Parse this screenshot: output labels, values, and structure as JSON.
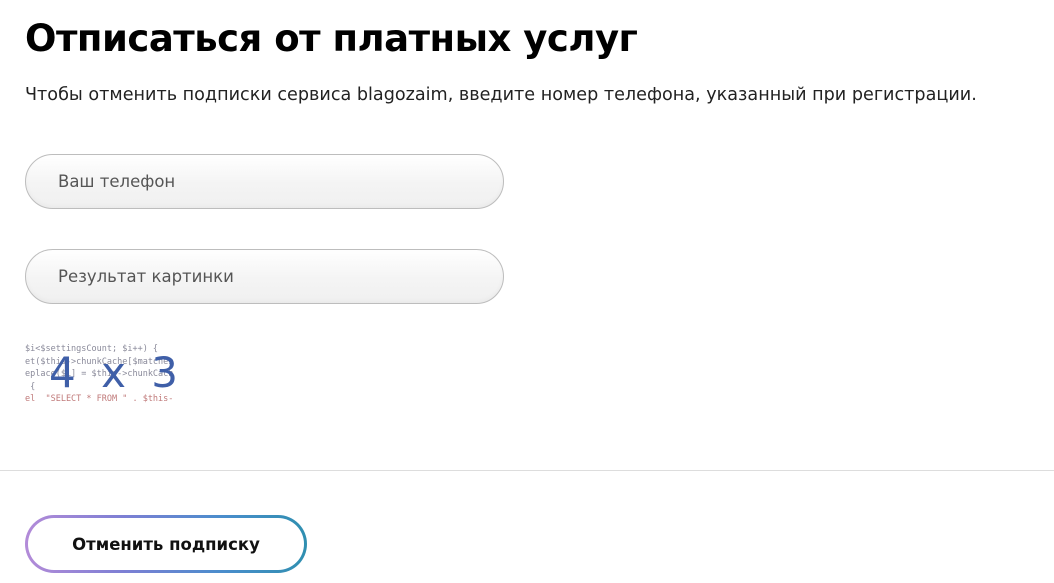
{
  "page": {
    "title": "Отписаться от платных услуг",
    "subtitle": "Чтобы отменить подписки сервиса blagozaim, введите номер телефона, указанный при регистрации."
  },
  "form": {
    "phone": {
      "placeholder": "Ваш телефон",
      "value": ""
    },
    "captcha_answer": {
      "placeholder": "Результат картинки",
      "value": ""
    },
    "captcha_image": {
      "expression": "4 x 3",
      "background_code": [
        "$i<$settingsCount; $i++) {",
        "et($this->chunkCache[$matches",
        "eplace($i] = $this->chunkCach",
        " {",
        "el  \"SELECT * FROM \" . $this-"
      ]
    },
    "submit_label": "Отменить подписку"
  },
  "colors": {
    "title": "#000000",
    "captcha_digits": "#3f5fa8",
    "button_gradient_start": "#b38bd8",
    "button_gradient_end": "#2f8fb0",
    "divider": "#dddddd"
  }
}
